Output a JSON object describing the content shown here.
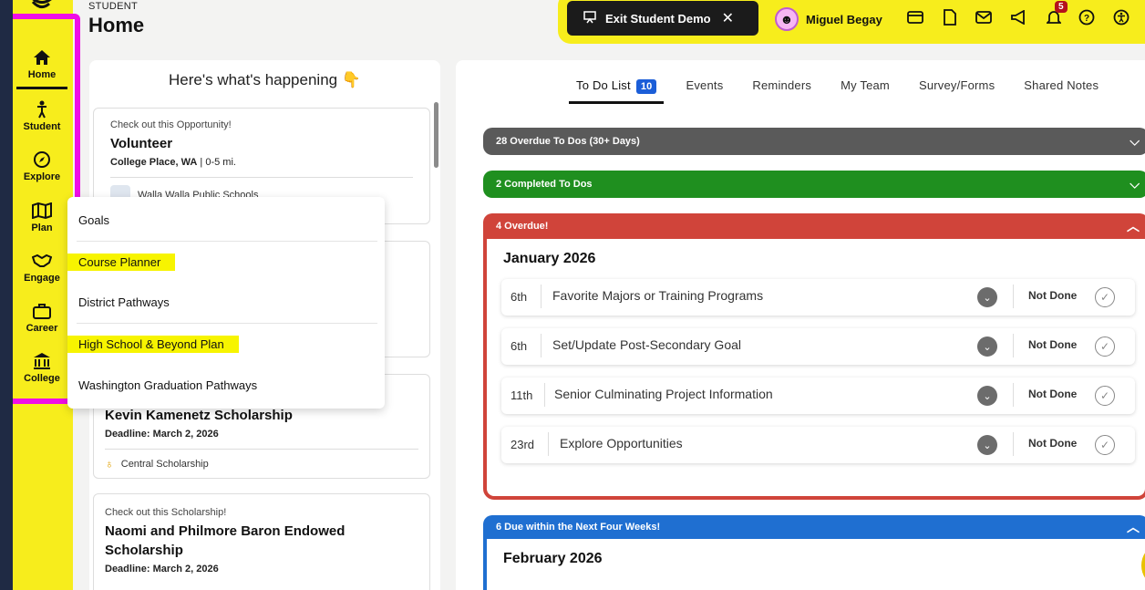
{
  "header": {
    "small_label": "STUDENT",
    "title": "Home"
  },
  "leftnav": {
    "items": [
      {
        "label": "Home",
        "icon": "home-icon"
      },
      {
        "label": "Student",
        "icon": "person-icon"
      },
      {
        "label": "Explore",
        "icon": "compass-icon"
      },
      {
        "label": "Plan",
        "icon": "map-icon"
      },
      {
        "label": "Engage",
        "icon": "handshake-icon"
      },
      {
        "label": "Career",
        "icon": "briefcase-icon"
      },
      {
        "label": "College",
        "icon": "college-icon"
      }
    ]
  },
  "topbar": {
    "exit_label": "Exit Student Demo",
    "user_name": "Miguel Begay",
    "notification_count": "5"
  },
  "happening": {
    "title": "Here's what's happening 👇",
    "cards": [
      {
        "kicker": "Check out this Opportunity!",
        "title": "Volunteer",
        "meta_bold": "College Place, WA",
        "meta_light": " | 0-5 mi.",
        "foot": "Walla Walla Public Schools"
      },
      {
        "title": "Kevin Kamenetz Scholarship",
        "meta_bold": "Deadline: March 2, 2026",
        "foot": "Central Scholarship"
      },
      {
        "kicker": "Check out this Scholarship!",
        "title": "Naomi and Philmore Baron Endowed Scholarship",
        "meta_bold": "Deadline: March 2, 2026"
      }
    ]
  },
  "dropdown": {
    "items": [
      {
        "label": "Goals",
        "highlight": false
      },
      {
        "label": "Course Planner",
        "highlight": true
      },
      {
        "label": "District Pathways",
        "highlight": false
      },
      {
        "label": "High School & Beyond Plan",
        "highlight": true
      },
      {
        "label": "Washington Graduation Pathways",
        "highlight": false
      }
    ]
  },
  "tabs": [
    {
      "label": "To Do List",
      "count": "10"
    },
    {
      "label": "Events"
    },
    {
      "label": "Reminders"
    },
    {
      "label": "My Team"
    },
    {
      "label": "Survey/Forms"
    },
    {
      "label": "Shared Notes"
    }
  ],
  "sections": {
    "overdue_30": "28 Overdue To Dos (30+ Days)",
    "completed": "2 Completed To Dos",
    "overdue": "4 Overdue!",
    "due_soon": "6 Due within the Next Four Weeks!"
  },
  "months": {
    "january": "January 2026",
    "february": "February 2026"
  },
  "todos": [
    {
      "day": "6th",
      "title": "Favorite Majors or Training Programs",
      "status": "Not Done"
    },
    {
      "day": "6th",
      "title": "Set/Update Post-Secondary Goal",
      "status": "Not Done"
    },
    {
      "day": "11th",
      "title": "Senior Culminating Project Information",
      "status": "Not Done"
    },
    {
      "day": "23rd",
      "title": "Explore Opportunities",
      "status": "Not Done"
    }
  ],
  "colors": {
    "accent_yellow": "#f7ed1c",
    "highlight_magenta": "#f00ee6",
    "overdue_30": "#5a5a5a",
    "completed": "#1f8f1f",
    "overdue": "#d0443a",
    "due_soon": "#1f6fd1"
  }
}
